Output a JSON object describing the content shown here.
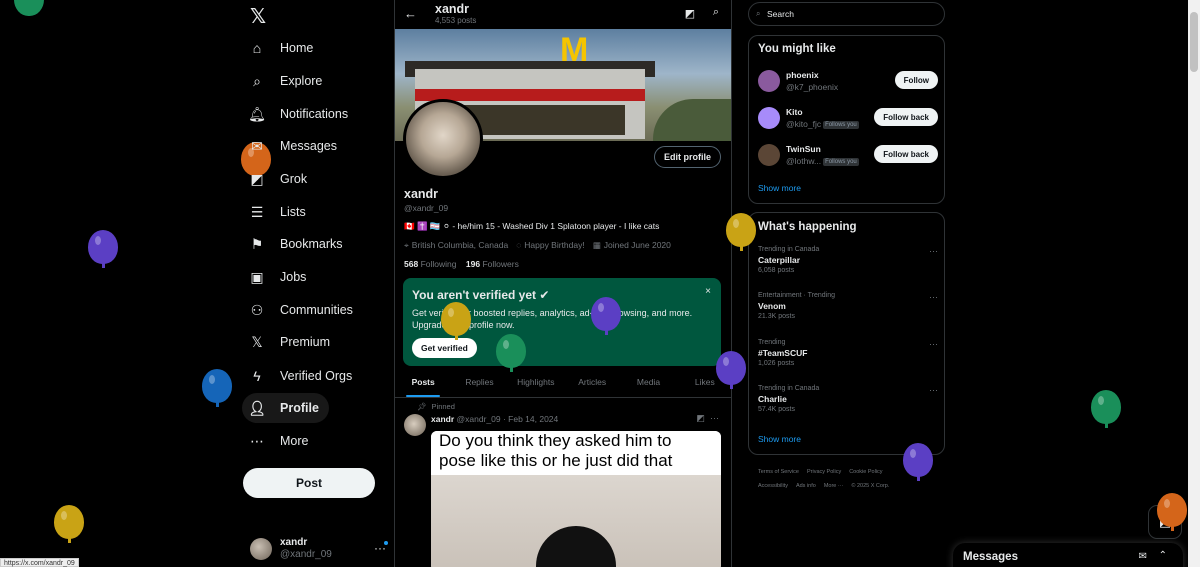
{
  "nav": {
    "logo": "𝕏",
    "items": [
      {
        "label": "Home",
        "icon": "⌂",
        "icon_name": "home-icon"
      },
      {
        "label": "Explore",
        "icon": "⌕",
        "icon_name": "search-icon"
      },
      {
        "label": "Notifications",
        "icon": "🔔︎",
        "icon_name": "bell-icon"
      },
      {
        "label": "Messages",
        "icon": "✉",
        "icon_name": "envelope-icon"
      },
      {
        "label": "Grok",
        "icon": "◩",
        "icon_name": "grok-icon"
      },
      {
        "label": "Lists",
        "icon": "☰",
        "icon_name": "lists-icon"
      },
      {
        "label": "Bookmarks",
        "icon": "⚑",
        "icon_name": "bookmark-icon"
      },
      {
        "label": "Jobs",
        "icon": "▣",
        "icon_name": "briefcase-icon"
      },
      {
        "label": "Communities",
        "icon": "⚇",
        "icon_name": "communities-icon"
      },
      {
        "label": "Premium",
        "icon": "𝕏",
        "icon_name": "premium-icon"
      },
      {
        "label": "Verified Orgs",
        "icon": "ϟ",
        "icon_name": "lightning-icon"
      },
      {
        "label": "Profile",
        "icon": "👤︎",
        "icon_name": "person-icon"
      },
      {
        "label": "More",
        "icon": "⋯",
        "icon_name": "more-circle-icon"
      }
    ],
    "post_label": "Post",
    "account": {
      "name": "xandr",
      "handle": "@xandr_09",
      "more": "···"
    }
  },
  "profile": {
    "title": "xandr",
    "post_count": "4,553 posts",
    "back": "←",
    "name": "xandr",
    "handle": "@xandr_09",
    "edit_label": "Edit profile",
    "bio": "🇨🇦 ✝️ 🏳️‍⚧️ ⚪ - he/him 15 - Washed Div 1 Splatoon player - I like cats",
    "location": "British Columbia, Canada",
    "birthday": "Happy Birthday!",
    "joined": "Joined June 2020",
    "following_count": "568",
    "following_label": "Following",
    "followers_count": "196",
    "followers_label": "Followers",
    "banner_text": "McDonald's"
  },
  "verify": {
    "title": "You aren't verified yet",
    "desc": "Get verified for boosted replies, analytics, ad-free browsing, and more. Upgrade your profile now.",
    "button": "Get verified",
    "close": "×"
  },
  "tabs": [
    "Posts",
    "Replies",
    "Highlights",
    "Articles",
    "Media",
    "Likes"
  ],
  "tweet": {
    "pinned": "Pinned",
    "name": "xandr",
    "meta": "@xandr_09 · Feb 14, 2024",
    "caption": "Do you think they asked him to pose like this or he just did that"
  },
  "search": {
    "placeholder": "Search"
  },
  "you_might_like": {
    "title": "You might like",
    "users": [
      {
        "name": "phoenix",
        "handle": "@k7_phoenix",
        "follows_you": "",
        "button": "Follow",
        "color": "#8a5a9e"
      },
      {
        "name": "Kito",
        "handle": "@kito_fjc",
        "follows_you": "Follows you",
        "button": "Follow back",
        "color": "#a78bfa"
      },
      {
        "name": "TwinSun",
        "handle": "@lothw...",
        "follows_you": "Follows you",
        "button": "Follow back",
        "color": "#5b4636"
      }
    ],
    "show_more": "Show more"
  },
  "happening": {
    "title": "What's happening",
    "trends": [
      {
        "context": "Trending in Canada",
        "name": "Caterpillar",
        "posts": "6,058 posts"
      },
      {
        "context": "Entertainment · Trending",
        "name": "Venom",
        "posts": "21.3K posts"
      },
      {
        "context": "Trending",
        "name": "#TeamSCUF",
        "posts": "1,026 posts"
      },
      {
        "context": "Trending in Canada",
        "name": "Charlie",
        "posts": "57.4K posts"
      }
    ],
    "show_more": "Show more"
  },
  "footer": {
    "links": [
      "Terms of Service",
      "Privacy Policy",
      "Cookie Policy",
      "Accessibility",
      "Ads info",
      "More ···",
      "© 2025 X Corp."
    ]
  },
  "messages": {
    "title": "Messages"
  },
  "status_url": "https://x.com/xandr_09",
  "colors": {
    "accent": "#1d9bf0",
    "verify_bg": "#00573e",
    "bg": "#000000"
  }
}
